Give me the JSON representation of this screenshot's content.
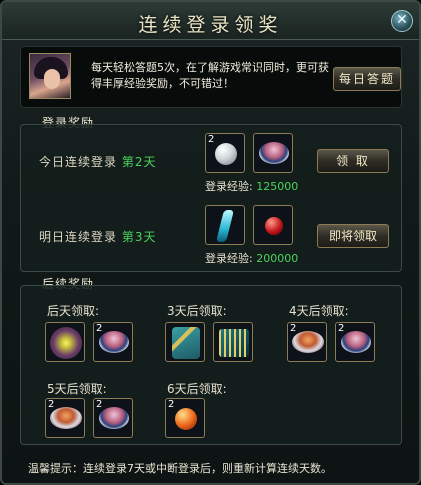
{
  "window": {
    "title": "连续登录领奖",
    "close_glyph": "✕"
  },
  "quiz": {
    "text": "每天轻松答题5次，在了解游戏常识同时，更可获得丰厚经验奖励，不可错过！",
    "button": "每日答题"
  },
  "login_section": {
    "heading": "登录奖励",
    "today": {
      "label": "今日连续登录",
      "days": "第2天",
      "exp_label": "登录经验:",
      "exp_value": "125000",
      "button": "领 取",
      "items": [
        {
          "icon": "white-pearl-icon",
          "count": "2"
        },
        {
          "icon": "pink-bowl-icon",
          "count": ""
        }
      ]
    },
    "tomorrow": {
      "label": "明日连续登录",
      "days": "第3天",
      "exp_label": "登录经验:",
      "exp_value": "200000",
      "button": "即将领取",
      "items": [
        {
          "icon": "cyan-crystal-icon",
          "count": ""
        },
        {
          "icon": "red-gem-icon",
          "count": ""
        }
      ]
    }
  },
  "later_section": {
    "heading": "后续奖励",
    "groups": [
      {
        "label": "后天领取:",
        "items": [
          {
            "icon": "scroll-orb-icon",
            "count": ""
          },
          {
            "icon": "pink-bowl-icon",
            "count": "2"
          }
        ]
      },
      {
        "label": "3天后领取:",
        "items": [
          {
            "icon": "branch-icon",
            "count": ""
          },
          {
            "icon": "comb-icon",
            "count": ""
          }
        ]
      },
      {
        "label": "4天后领取:",
        "items": [
          {
            "icon": "orange-bowl-icon",
            "count": "2"
          },
          {
            "icon": "pink-bowl-icon",
            "count": "2"
          }
        ]
      },
      {
        "label": "5天后领取:",
        "items": [
          {
            "icon": "orange-bowl-icon",
            "count": "2"
          },
          {
            "icon": "pink-bowl-icon",
            "count": "2"
          }
        ]
      },
      {
        "label": "6天后领取:",
        "items": [
          {
            "icon": "fire-orb-icon",
            "count": "2"
          }
        ]
      }
    ]
  },
  "tip": "温馨提示：连续登录7天或中断登录后，则重新计算连续天数。"
}
